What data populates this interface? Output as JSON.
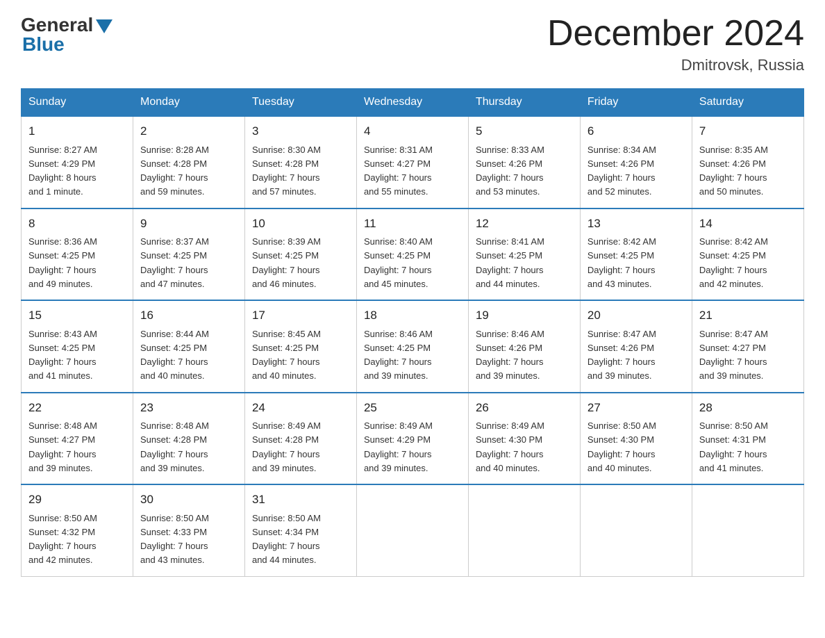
{
  "logo": {
    "general": "General",
    "blue": "Blue"
  },
  "title": "December 2024",
  "location": "Dmitrovsk, Russia",
  "days_of_week": [
    "Sunday",
    "Monday",
    "Tuesday",
    "Wednesday",
    "Thursday",
    "Friday",
    "Saturday"
  ],
  "weeks": [
    [
      {
        "day": "1",
        "sunrise": "Sunrise: 8:27 AM",
        "sunset": "Sunset: 4:29 PM",
        "daylight": "Daylight: 8 hours",
        "daylight2": "and 1 minute."
      },
      {
        "day": "2",
        "sunrise": "Sunrise: 8:28 AM",
        "sunset": "Sunset: 4:28 PM",
        "daylight": "Daylight: 7 hours",
        "daylight2": "and 59 minutes."
      },
      {
        "day": "3",
        "sunrise": "Sunrise: 8:30 AM",
        "sunset": "Sunset: 4:28 PM",
        "daylight": "Daylight: 7 hours",
        "daylight2": "and 57 minutes."
      },
      {
        "day": "4",
        "sunrise": "Sunrise: 8:31 AM",
        "sunset": "Sunset: 4:27 PM",
        "daylight": "Daylight: 7 hours",
        "daylight2": "and 55 minutes."
      },
      {
        "day": "5",
        "sunrise": "Sunrise: 8:33 AM",
        "sunset": "Sunset: 4:26 PM",
        "daylight": "Daylight: 7 hours",
        "daylight2": "and 53 minutes."
      },
      {
        "day": "6",
        "sunrise": "Sunrise: 8:34 AM",
        "sunset": "Sunset: 4:26 PM",
        "daylight": "Daylight: 7 hours",
        "daylight2": "and 52 minutes."
      },
      {
        "day": "7",
        "sunrise": "Sunrise: 8:35 AM",
        "sunset": "Sunset: 4:26 PM",
        "daylight": "Daylight: 7 hours",
        "daylight2": "and 50 minutes."
      }
    ],
    [
      {
        "day": "8",
        "sunrise": "Sunrise: 8:36 AM",
        "sunset": "Sunset: 4:25 PM",
        "daylight": "Daylight: 7 hours",
        "daylight2": "and 49 minutes."
      },
      {
        "day": "9",
        "sunrise": "Sunrise: 8:37 AM",
        "sunset": "Sunset: 4:25 PM",
        "daylight": "Daylight: 7 hours",
        "daylight2": "and 47 minutes."
      },
      {
        "day": "10",
        "sunrise": "Sunrise: 8:39 AM",
        "sunset": "Sunset: 4:25 PM",
        "daylight": "Daylight: 7 hours",
        "daylight2": "and 46 minutes."
      },
      {
        "day": "11",
        "sunrise": "Sunrise: 8:40 AM",
        "sunset": "Sunset: 4:25 PM",
        "daylight": "Daylight: 7 hours",
        "daylight2": "and 45 minutes."
      },
      {
        "day": "12",
        "sunrise": "Sunrise: 8:41 AM",
        "sunset": "Sunset: 4:25 PM",
        "daylight": "Daylight: 7 hours",
        "daylight2": "and 44 minutes."
      },
      {
        "day": "13",
        "sunrise": "Sunrise: 8:42 AM",
        "sunset": "Sunset: 4:25 PM",
        "daylight": "Daylight: 7 hours",
        "daylight2": "and 43 minutes."
      },
      {
        "day": "14",
        "sunrise": "Sunrise: 8:42 AM",
        "sunset": "Sunset: 4:25 PM",
        "daylight": "Daylight: 7 hours",
        "daylight2": "and 42 minutes."
      }
    ],
    [
      {
        "day": "15",
        "sunrise": "Sunrise: 8:43 AM",
        "sunset": "Sunset: 4:25 PM",
        "daylight": "Daylight: 7 hours",
        "daylight2": "and 41 minutes."
      },
      {
        "day": "16",
        "sunrise": "Sunrise: 8:44 AM",
        "sunset": "Sunset: 4:25 PM",
        "daylight": "Daylight: 7 hours",
        "daylight2": "and 40 minutes."
      },
      {
        "day": "17",
        "sunrise": "Sunrise: 8:45 AM",
        "sunset": "Sunset: 4:25 PM",
        "daylight": "Daylight: 7 hours",
        "daylight2": "and 40 minutes."
      },
      {
        "day": "18",
        "sunrise": "Sunrise: 8:46 AM",
        "sunset": "Sunset: 4:25 PM",
        "daylight": "Daylight: 7 hours",
        "daylight2": "and 39 minutes."
      },
      {
        "day": "19",
        "sunrise": "Sunrise: 8:46 AM",
        "sunset": "Sunset: 4:26 PM",
        "daylight": "Daylight: 7 hours",
        "daylight2": "and 39 minutes."
      },
      {
        "day": "20",
        "sunrise": "Sunrise: 8:47 AM",
        "sunset": "Sunset: 4:26 PM",
        "daylight": "Daylight: 7 hours",
        "daylight2": "and 39 minutes."
      },
      {
        "day": "21",
        "sunrise": "Sunrise: 8:47 AM",
        "sunset": "Sunset: 4:27 PM",
        "daylight": "Daylight: 7 hours",
        "daylight2": "and 39 minutes."
      }
    ],
    [
      {
        "day": "22",
        "sunrise": "Sunrise: 8:48 AM",
        "sunset": "Sunset: 4:27 PM",
        "daylight": "Daylight: 7 hours",
        "daylight2": "and 39 minutes."
      },
      {
        "day": "23",
        "sunrise": "Sunrise: 8:48 AM",
        "sunset": "Sunset: 4:28 PM",
        "daylight": "Daylight: 7 hours",
        "daylight2": "and 39 minutes."
      },
      {
        "day": "24",
        "sunrise": "Sunrise: 8:49 AM",
        "sunset": "Sunset: 4:28 PM",
        "daylight": "Daylight: 7 hours",
        "daylight2": "and 39 minutes."
      },
      {
        "day": "25",
        "sunrise": "Sunrise: 8:49 AM",
        "sunset": "Sunset: 4:29 PM",
        "daylight": "Daylight: 7 hours",
        "daylight2": "and 39 minutes."
      },
      {
        "day": "26",
        "sunrise": "Sunrise: 8:49 AM",
        "sunset": "Sunset: 4:30 PM",
        "daylight": "Daylight: 7 hours",
        "daylight2": "and 40 minutes."
      },
      {
        "day": "27",
        "sunrise": "Sunrise: 8:50 AM",
        "sunset": "Sunset: 4:30 PM",
        "daylight": "Daylight: 7 hours",
        "daylight2": "and 40 minutes."
      },
      {
        "day": "28",
        "sunrise": "Sunrise: 8:50 AM",
        "sunset": "Sunset: 4:31 PM",
        "daylight": "Daylight: 7 hours",
        "daylight2": "and 41 minutes."
      }
    ],
    [
      {
        "day": "29",
        "sunrise": "Sunrise: 8:50 AM",
        "sunset": "Sunset: 4:32 PM",
        "daylight": "Daylight: 7 hours",
        "daylight2": "and 42 minutes."
      },
      {
        "day": "30",
        "sunrise": "Sunrise: 8:50 AM",
        "sunset": "Sunset: 4:33 PM",
        "daylight": "Daylight: 7 hours",
        "daylight2": "and 43 minutes."
      },
      {
        "day": "31",
        "sunrise": "Sunrise: 8:50 AM",
        "sunset": "Sunset: 4:34 PM",
        "daylight": "Daylight: 7 hours",
        "daylight2": "and 44 minutes."
      },
      null,
      null,
      null,
      null
    ]
  ]
}
